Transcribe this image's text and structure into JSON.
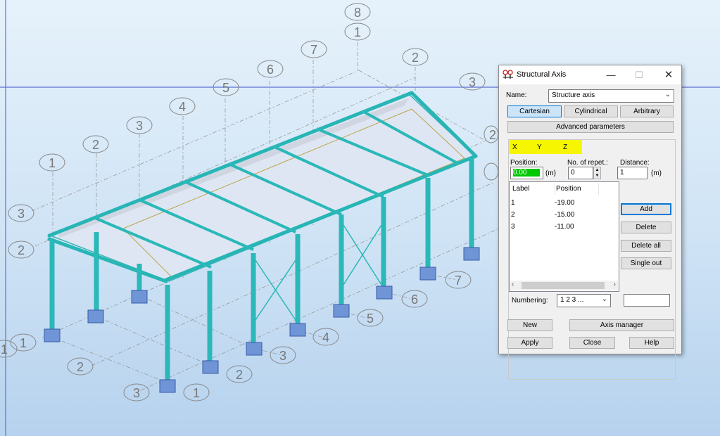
{
  "viewport": {
    "axis_labels_top": [
      "8",
      "1",
      "7",
      "2",
      "6",
      "5",
      "4",
      "3",
      "2",
      "1",
      "3",
      "3",
      "2",
      "2"
    ],
    "axis_labels_bottom": [
      "1",
      "1",
      "2",
      "3",
      "1",
      "2",
      "3",
      "4",
      "5",
      "6",
      "7"
    ]
  },
  "dialog": {
    "title": "Structural Axis",
    "name_label": "Name:",
    "name_value": "Structure axis",
    "tabs_type": [
      "Cartesian",
      "Cylindrical",
      "Arbitrary"
    ],
    "advanced_label": "Advanced parameters",
    "axis_tabs": [
      "X",
      "Y",
      "Z"
    ],
    "position_label": "Position:",
    "position_value": "0.00",
    "position_unit": "(m)",
    "repet_label": "No. of repet.:",
    "repet_value": "0",
    "distance_label": "Distance:",
    "distance_value": "1",
    "distance_unit": "(m)",
    "list_headers": [
      "Label",
      "Position"
    ],
    "list_rows": [
      {
        "label": "1",
        "position": "-19.00"
      },
      {
        "label": "2",
        "position": "-15.00"
      },
      {
        "label": "3",
        "position": "-11.00"
      }
    ],
    "side_buttons": [
      "Add",
      "Delete",
      "Delete all",
      "Single out"
    ],
    "numbering_label": "Numbering:",
    "numbering_value": "1 2 3 ...",
    "buttons_row1": [
      "New",
      "Axis manager"
    ],
    "buttons_row2": [
      "Apply",
      "Close",
      "Help"
    ],
    "highlight_color": "#f6f600",
    "accent_color": "#0078d7",
    "selection_color": "#00c800"
  }
}
